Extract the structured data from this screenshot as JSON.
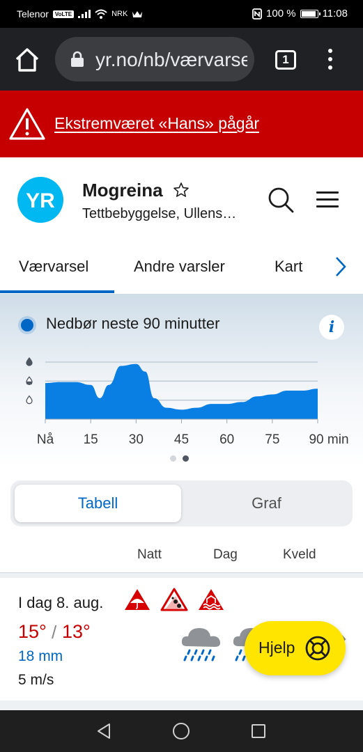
{
  "status_bar": {
    "carrier": "Telenor",
    "volte": "VoLTE",
    "nrk": "NRK",
    "battery": "100 %",
    "battery_level": 1.0,
    "time": "11:08"
  },
  "browser": {
    "url": "yr.no/nb/værvarsel",
    "tab_count": "1"
  },
  "alert": {
    "text": "Ekstremværet «Hans» pågår",
    "color": "#c60000"
  },
  "header": {
    "logo_text": "YR",
    "title": "Mogreina",
    "subtitle": "Tettbebyggelse, Ullens…"
  },
  "nav": {
    "tabs": [
      {
        "label": "Værvarsel",
        "active": true
      },
      {
        "label": "Andre varsler",
        "active": false
      },
      {
        "label": "Kart",
        "active": false
      }
    ]
  },
  "nowcast": {
    "title": "Nedbør neste 90 minutter",
    "info": "i",
    "pages": 2,
    "active_page": 2
  },
  "chart_data": {
    "type": "area",
    "x": [
      0,
      5,
      10,
      15,
      18,
      21,
      25,
      30,
      33,
      36,
      40,
      45,
      50,
      55,
      60,
      65,
      70,
      75,
      80,
      85,
      90
    ],
    "values": [
      1.9,
      1.95,
      1.95,
      1.8,
      1.1,
      1.8,
      2.8,
      2.9,
      2.5,
      1.1,
      0.6,
      0.5,
      0.6,
      0.8,
      0.8,
      0.9,
      1.2,
      1.3,
      1.5,
      1.5,
      1.6
    ],
    "ylim": [
      0,
      3
    ],
    "y_levels": [
      "light",
      "moderate",
      "heavy"
    ],
    "xticks": [
      "Nå",
      "15",
      "30",
      "45",
      "60",
      "75",
      "90 min"
    ],
    "xtick_values": [
      0,
      15,
      30,
      45,
      60,
      75,
      90
    ],
    "grid": true,
    "color": "#0a7fe3"
  },
  "view_toggle": {
    "active": "Tabell",
    "inactive": "Graf"
  },
  "columns": [
    "Natt",
    "Dag",
    "Kveld"
  ],
  "day": {
    "title": "I dag 8. aug.",
    "temp_high": "15°",
    "temp_sep": "/",
    "temp_low": "13°",
    "precip": "18 mm",
    "wind": "5 m/s",
    "warnings": [
      "rain-warning-icon",
      "landslide-warning-icon",
      "flood-warning-icon"
    ],
    "weather_icons": [
      "heavy-rain-cloud-icon",
      "heavy-rain-cloud-icon"
    ]
  },
  "help": {
    "label": "Hjelp"
  }
}
